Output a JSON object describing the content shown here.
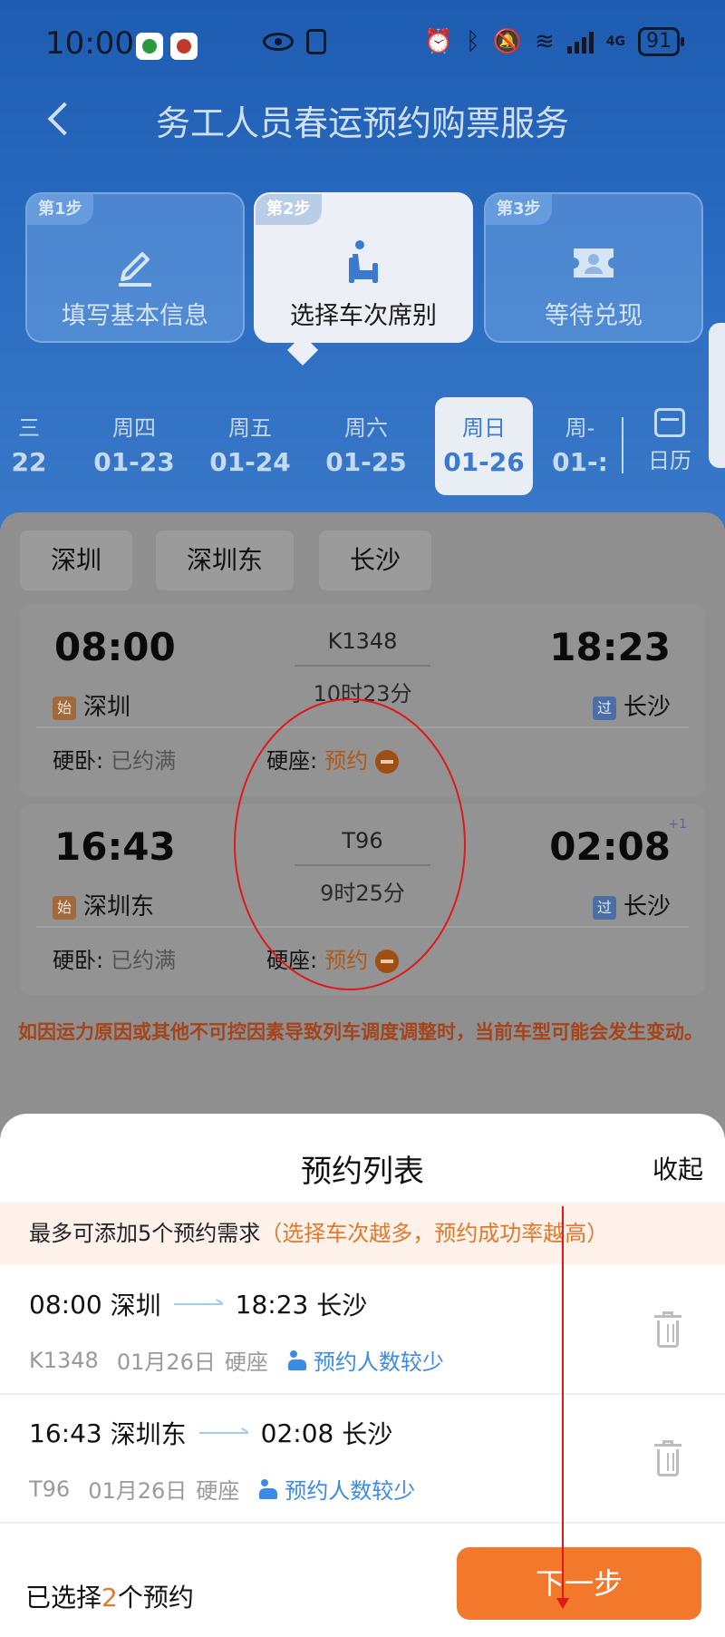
{
  "status_bar": {
    "time": "10:00",
    "battery": "91",
    "network": "4G"
  },
  "header": {
    "title": "务工人员春运预约购票服务"
  },
  "steps": [
    {
      "tag": "第1步",
      "label": "填写基本信息",
      "icon": "pencil-icon"
    },
    {
      "tag": "第2步",
      "label": "选择车次席别",
      "icon": "seat-icon"
    },
    {
      "tag": "第3步",
      "label": "等待兑现",
      "icon": "ticket-icon"
    }
  ],
  "dates": [
    {
      "weekday": "三",
      "date": "22"
    },
    {
      "weekday": "周四",
      "date": "01-23"
    },
    {
      "weekday": "周五",
      "date": "01-24"
    },
    {
      "weekday": "周六",
      "date": "01-25"
    },
    {
      "weekday": "周日",
      "date": "01-26"
    },
    {
      "weekday": "周-",
      "date": "01-:"
    }
  ],
  "calendar_label": "日历",
  "stations": [
    "深圳",
    "深圳东",
    "长沙"
  ],
  "trains": [
    {
      "dep_time": "08:00",
      "dep_tag": "始",
      "dep_station": "深圳",
      "train_no": "K1348",
      "duration": "10时23分",
      "arr_time": "18:23",
      "arr_tag": "过",
      "arr_station": "长沙",
      "arr_plus": "",
      "seat1_type": "硬卧:",
      "seat1_status": "已约满",
      "seat2_type": "硬座:",
      "seat2_status": "预约"
    },
    {
      "dep_time": "16:43",
      "dep_tag": "始",
      "dep_station": "深圳东",
      "train_no": "T96",
      "duration": "9时25分",
      "arr_time": "02:08",
      "arr_tag": "过",
      "arr_station": "长沙",
      "arr_plus": "+1",
      "seat1_type": "硬卧:",
      "seat1_status": "已约满",
      "seat2_type": "硬座:",
      "seat2_status": "预约"
    }
  ],
  "notice": "如因运力原因或其他不可控因素导致列车调度调整时，当前车型可能会发生变动。",
  "sheet": {
    "title": "预约列表",
    "collapse": "收起",
    "tip": "最多可添加5个预约需求",
    "tip_hint": "（选择车次越多，预约成功率越高）",
    "reservations": [
      {
        "dep_time": "08:00",
        "dep_station": "深圳",
        "arr_time": "18:23",
        "arr_station": "长沙",
        "train_no": "K1348",
        "date": "01月26日",
        "seat": "硬座",
        "badge": "预约人数较少"
      },
      {
        "dep_time": "16:43",
        "dep_station": "深圳东",
        "arr_time": "02:08",
        "arr_station": "长沙",
        "train_no": "T96",
        "date": "01月26日",
        "seat": "硬座",
        "badge": "预约人数较少"
      }
    ],
    "selected_prefix": "已选择",
    "selected_count": "2",
    "selected_suffix": "个预约",
    "next": "下一步"
  },
  "colors": {
    "primary_blue": "#1f5fb3",
    "accent_orange": "#f2782c",
    "annotation_red": "#e01818"
  }
}
